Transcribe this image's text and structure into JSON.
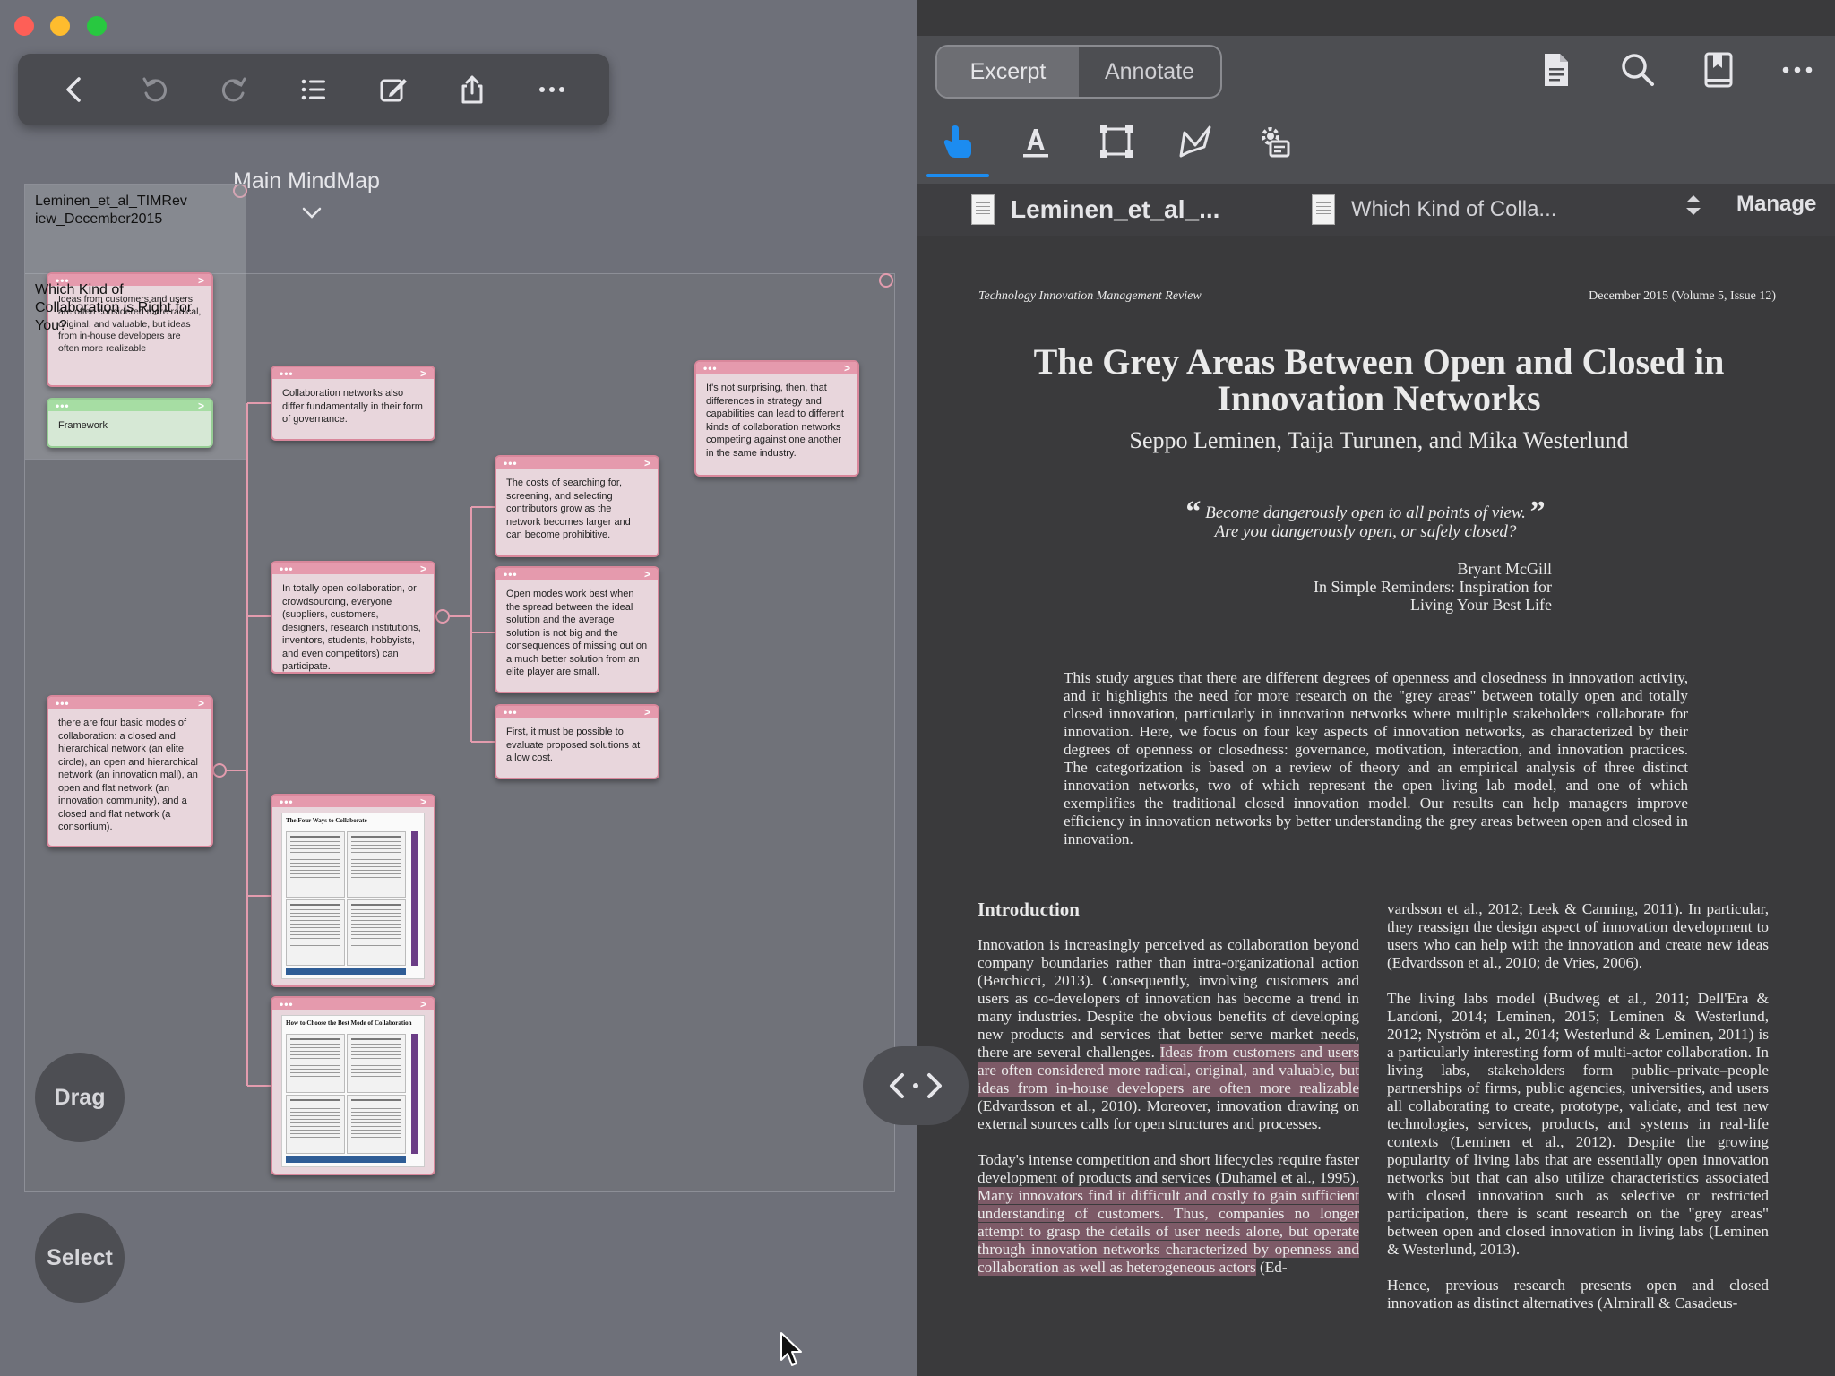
{
  "left": {
    "mindmap_title": "Main MindMap",
    "minimap": {
      "doc_label": "Leminen_et_al_TIMReview_December2015",
      "overlay_label": "Which Kind of Collaboration is Right for You?"
    },
    "nodes": {
      "ideas": "Ideas from customers and users are often considered more radical, original, and valuable, but ideas from in-house developers are often more realizable",
      "framework": "Framework",
      "governance": "Collaboration networks also differ fundamentally in their form of governance.",
      "not_surprising": "It's not surprising, then, that differences in strategy and capabilities can lead to different kinds of collaboration networks competing against one another in the same industry.",
      "costs": "The costs of searching for, screening, and selecting contributors grow as the network becomes larger and can become prohibitive.",
      "open_collab": "In totally open collaboration, or crowdsourcing, everyone (suppliers, customers, designers, research institutions, inventors, students, hobbyists, and even competitors) can participate.",
      "open_modes": "Open modes work best when the spread between the ideal solution and the average solution is not big and the consequences of missing out on a much better solution from an elite player are small.",
      "first": "First, it must be possible to evaluate proposed solutions at a low cost.",
      "four_modes": "there are four basic modes of collaboration: a closed and hierarchical network (an elite circle), an open and hierarchical network (an innovation mall), an open and flat network (an innovation community), and a closed and flat network (a consortium).",
      "thumb1_title": "The Four Ways to Collaborate",
      "thumb2_title": "How to Choose the Best Mode of Collaboration"
    },
    "drag_label": "Drag",
    "select_label": "Select"
  },
  "right": {
    "segment": {
      "excerpt": "Excerpt",
      "annotate": "Annotate"
    },
    "tabs": {
      "tab1": "Leminen_et_al_...",
      "tab2": "Which Kind of Colla..."
    },
    "manage": "Manage",
    "pdf": {
      "journal": "Technology Innovation Management Review",
      "issue": "December 2015 (Volume 5, Issue 12)",
      "title": "The Grey Areas Between Open and Closed in Innovation Networks",
      "authors": "Seppo Leminen, Taija Turunen, and Mika Westerlund",
      "quote_line1": "Become dangerously open to all points of view.",
      "quote_line2": "Are you dangerously open, or safely closed?",
      "attrib_name": "Bryant McGill",
      "attrib_source": "In Simple Reminders: Inspiration for Living Your Best Life",
      "abstract": "This study argues that there are different degrees of openness and closedness in innovation activity, and it highlights the need for more research on the \"grey areas\" between totally open and totally closed innovation, particularly in innovation networks where multiple stakeholders collaborate for innovation. Here, we focus on four key aspects of innovation networks, as characterized by their degrees of openness or closedness: governance, motivation, interaction, and innovation practices. The categorization is based on a review of theory and an empirical analysis of three distinct innovation networks, two of which represent the open living lab model, and one of which exemplifies the traditional closed innovation model. Our results can help managers improve efficiency in innovation networks by better understanding the grey areas between open and closed in innovation.",
      "intro_heading": "Introduction",
      "p1_a": "Innovation is increasingly perceived as collaboration beyond company boundaries rather than intra-organizational action (Berchicci, 2013). Consequently, involving customers and users as co-developers of innovation has become a trend in many industries. Despite the obvious benefits of developing new products and services that better serve market needs, there are several challenges. ",
      "p1_hl": "Ideas from customers and users are often considered more radical, original, and valuable, but ideas from in-house developers are often more realizable",
      "p1_b": " (Edvardsson et al., 2010). Moreover, innovation drawing on external sources calls for open structures and processes.",
      "p2_a": "Today's intense competition and short lifecycles require faster development of products and services (Duhamel et al., 1995). ",
      "p2_hl": "Many innovators find it difficult and costly to gain sufficient understanding of customers. Thus, companies no longer attempt to grasp the details of user needs alone, but operate through innovation networks characterized by openness and collaboration as well as heterogeneous actors",
      "p2_b": " (Ed-",
      "r1": "vardsson et al., 2012; Leek & Canning, 2011). In particular, they reassign the design aspect of innovation development to users who can help with the innovation and create new ideas (Edvardsson et al., 2010; de Vries, 2006).",
      "r2": "The living labs model (Budweg et al., 2011; Dell'Era & Landoni, 2014; Leminen, 2015; Leminen & Westerlund, 2012; Nyström et al., 2014; Westerlund & Leminen, 2011) is a particularly interesting form of multi-actor collaboration. In living labs, stakeholders form public–private–people partnerships of firms, public agencies, universities, and users all collaborating to create, prototype, validate, and test new technologies, services, products, and systems in real-life contexts (Leminen et al., 2012). Despite the growing popularity of living labs that are essentially open innovation networks but that can also utilize characteristics associated with closed innovation such as selective or restricted participation, there is scant research on the \"grey areas\" between open and closed innovation in living labs (Leminen & Westerlund, 2013).",
      "r3": "Hence, previous research presents open and closed innovation as distinct alternatives (Almirall & Casadeus-"
    }
  }
}
